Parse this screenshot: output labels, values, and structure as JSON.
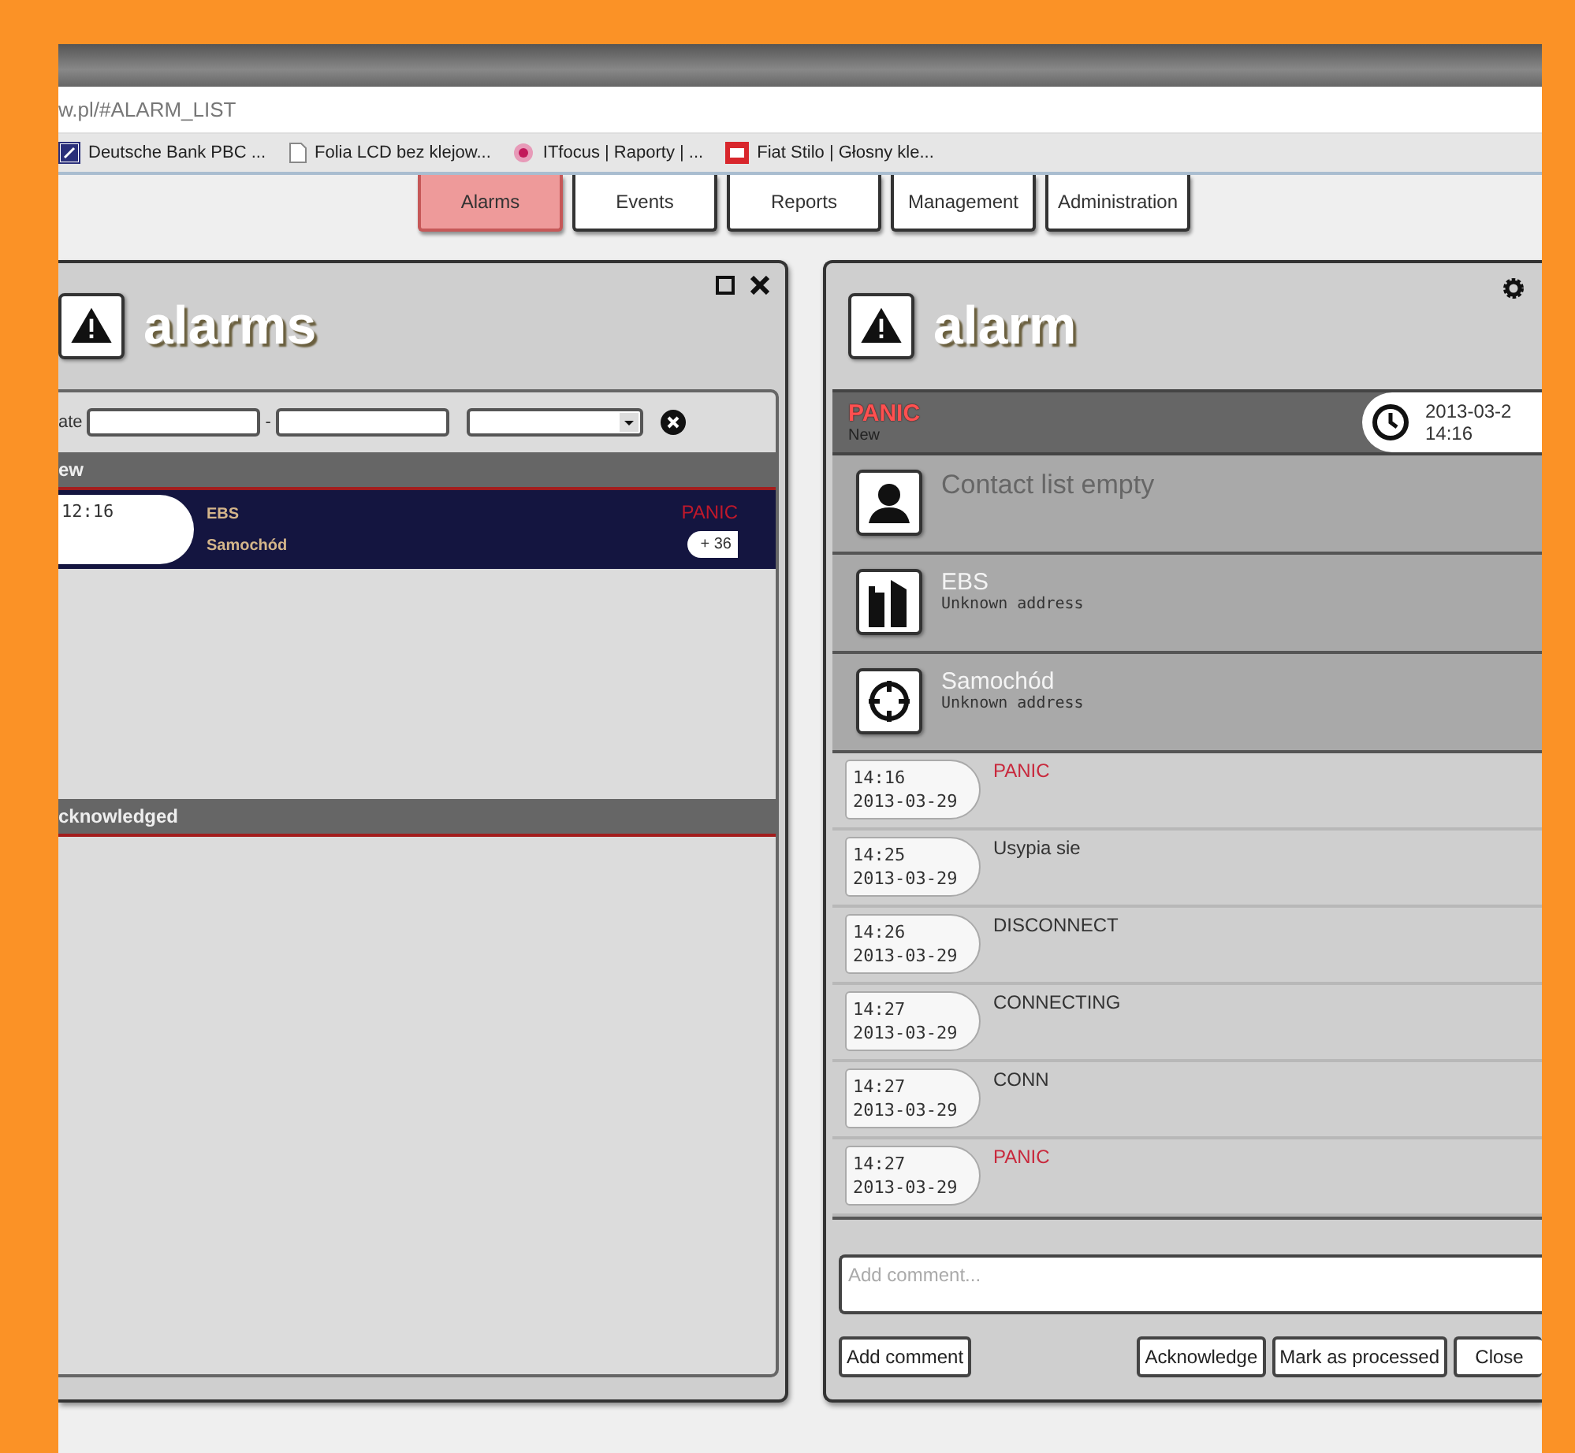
{
  "browser": {
    "address": "w.pl/#ALARM_LIST",
    "bookmarks": [
      {
        "label": "Deutsche Bank PBC ...",
        "kind": "bank"
      },
      {
        "label": "Folia LCD bez klejow...",
        "kind": "page"
      },
      {
        "label": "ITfocus | Raporty | ...",
        "kind": "flower"
      },
      {
        "label": "Fiat Stilo | Głosny kle...",
        "kind": "photo"
      }
    ]
  },
  "nav": [
    {
      "label": "Alarms",
      "selected": true
    },
    {
      "label": "Events",
      "selected": false
    },
    {
      "label": "Reports",
      "selected": false
    },
    {
      "label": "Management",
      "selected": false
    },
    {
      "label": "Administration",
      "selected": false
    }
  ],
  "alarms_panel": {
    "title": "alarms",
    "filter": {
      "date_label": "ate",
      "separator": "-"
    },
    "sections": [
      {
        "title": "ew",
        "alarms": [
          {
            "time": "12:16",
            "name": "EBS",
            "object": "Samochód",
            "type": "PANIC",
            "count": "+ 36",
            "selected": true
          }
        ]
      },
      {
        "title": "cknowledged"
      }
    ]
  },
  "alarm_panel": {
    "title": "alarm",
    "status": {
      "type": "PANIC",
      "state": "New",
      "date": "2013-03-2",
      "time": "14:16"
    },
    "details": [
      {
        "kind": "contacts",
        "name": "Contact list empty"
      },
      {
        "kind": "site",
        "name": "EBS",
        "address": "Unknown address"
      },
      {
        "kind": "object",
        "name": "Samochód",
        "address": "Unknown address"
      }
    ],
    "events": [
      {
        "time": "14:16",
        "date": "2013-03-29",
        "text": "PANIC",
        "kind": "alarm"
      },
      {
        "time": "14:25",
        "date": "2013-03-29",
        "text": "Usypia sie",
        "kind": "info"
      },
      {
        "time": "14:26",
        "date": "2013-03-29",
        "text": "DISCONNECT",
        "kind": "info"
      },
      {
        "time": "14:27",
        "date": "2013-03-29",
        "text": "CONNECTING",
        "kind": "info"
      },
      {
        "time": "14:27",
        "date": "2013-03-29",
        "text": "CONN",
        "kind": "info"
      },
      {
        "time": "14:27",
        "date": "2013-03-29",
        "text": "PANIC",
        "kind": "alarm"
      }
    ],
    "comment": {
      "placeholder": "Add comment..."
    },
    "buttons": [
      {
        "label": "Add comment",
        "kind": "left"
      },
      {
        "label": "Acknowledge",
        "kind": "right"
      },
      {
        "label": "Mark as processed",
        "kind": "right"
      },
      {
        "label": "Close",
        "kind": "right"
      }
    ]
  }
}
